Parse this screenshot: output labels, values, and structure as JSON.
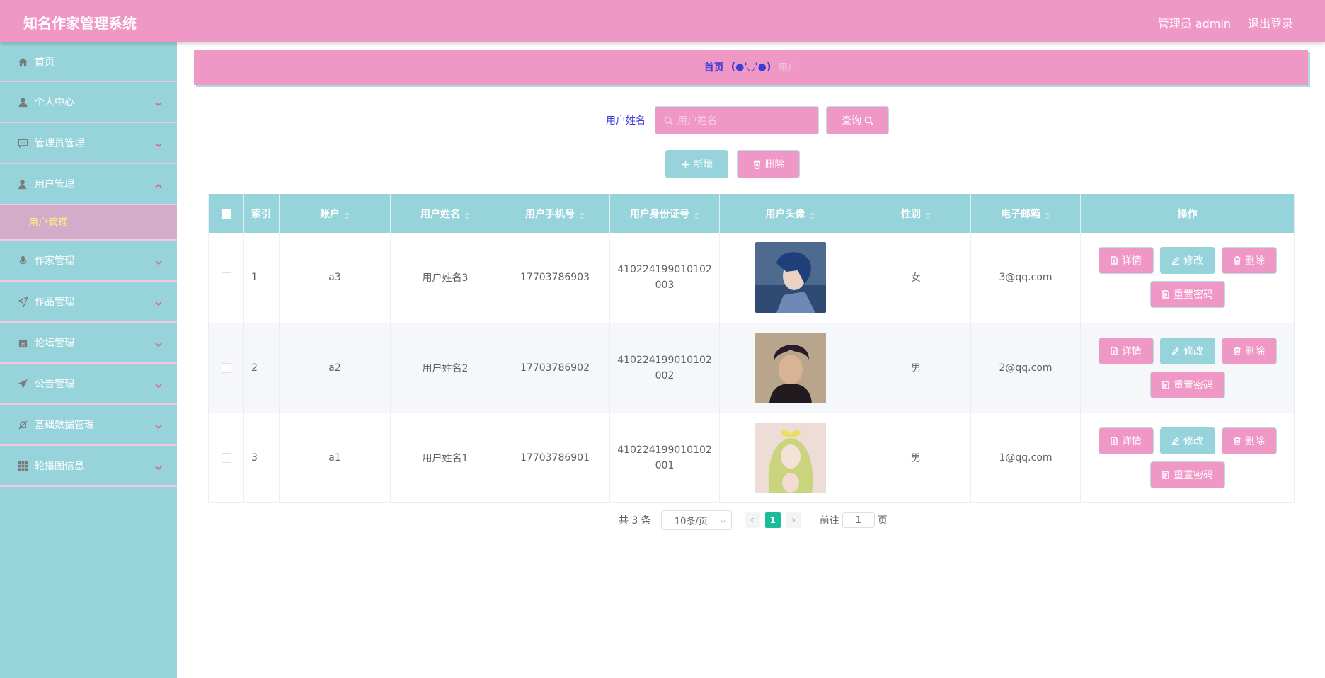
{
  "header": {
    "title": "知名作家管理系统",
    "user": "管理员 admin",
    "logout": "退出登录"
  },
  "sidebar": {
    "items": [
      {
        "label": "首页",
        "icon": "home-icon"
      },
      {
        "label": "个人中心",
        "icon": "user-icon"
      },
      {
        "label": "管理员管理",
        "icon": "chat-icon"
      },
      {
        "label": "用户管理",
        "icon": "user-manage-icon",
        "expanded": true
      },
      {
        "label": "作家管理",
        "icon": "mic-icon"
      },
      {
        "label": "作品管理",
        "icon": "send-icon"
      },
      {
        "label": "论坛管理",
        "icon": "box-icon"
      },
      {
        "label": "公告管理",
        "icon": "paper-plane-icon"
      },
      {
        "label": "基础数据管理",
        "icon": "bell-off-icon"
      },
      {
        "label": "轮播图信息",
        "icon": "grid-icon"
      }
    ],
    "submenu": {
      "label": "用户管理"
    }
  },
  "breadcrumb": {
    "home": "首页",
    "separator": "(●'◡'●)",
    "current": "用户"
  },
  "search": {
    "label": "用户姓名",
    "placeholder": "用户姓名",
    "value": "",
    "query_label": "查询"
  },
  "actions": {
    "add_label": "新增",
    "delete_label": "删除"
  },
  "table": {
    "headers": [
      "索引",
      "账户",
      "用户姓名",
      "用户手机号",
      "用户身份证号",
      "用户头像",
      "性别",
      "电子邮箱",
      "操作"
    ],
    "rows": [
      {
        "index": "1",
        "account": "a3",
        "name": "用户姓名3",
        "phone": "17703786903",
        "id_card": "410224199010102003",
        "avatar": "avatar-blue-hair",
        "gender": "女",
        "email": "3@qq.com"
      },
      {
        "index": "2",
        "account": "a2",
        "name": "用户姓名2",
        "phone": "17703786902",
        "id_card": "410224199010102002",
        "avatar": "avatar-dark-hair",
        "gender": "男",
        "email": "2@qq.com"
      },
      {
        "index": "3",
        "account": "a1",
        "name": "用户姓名1",
        "phone": "17703786901",
        "id_card": "410224199010102001",
        "avatar": "avatar-green-hair",
        "gender": "男",
        "email": "1@qq.com"
      }
    ],
    "row_actions": {
      "detail": "详情",
      "edit": "修改",
      "delete": "删除",
      "reset": "重置密码"
    }
  },
  "pagination": {
    "total": "共 3 条",
    "page_size": "10条/页",
    "current_page": "1",
    "goto_prefix": "前往",
    "goto_value": "1",
    "goto_suffix": "页"
  },
  "colors": {
    "pink": "#ef98c6",
    "teal": "#97d3da",
    "pager_active": "#1abc9c"
  }
}
